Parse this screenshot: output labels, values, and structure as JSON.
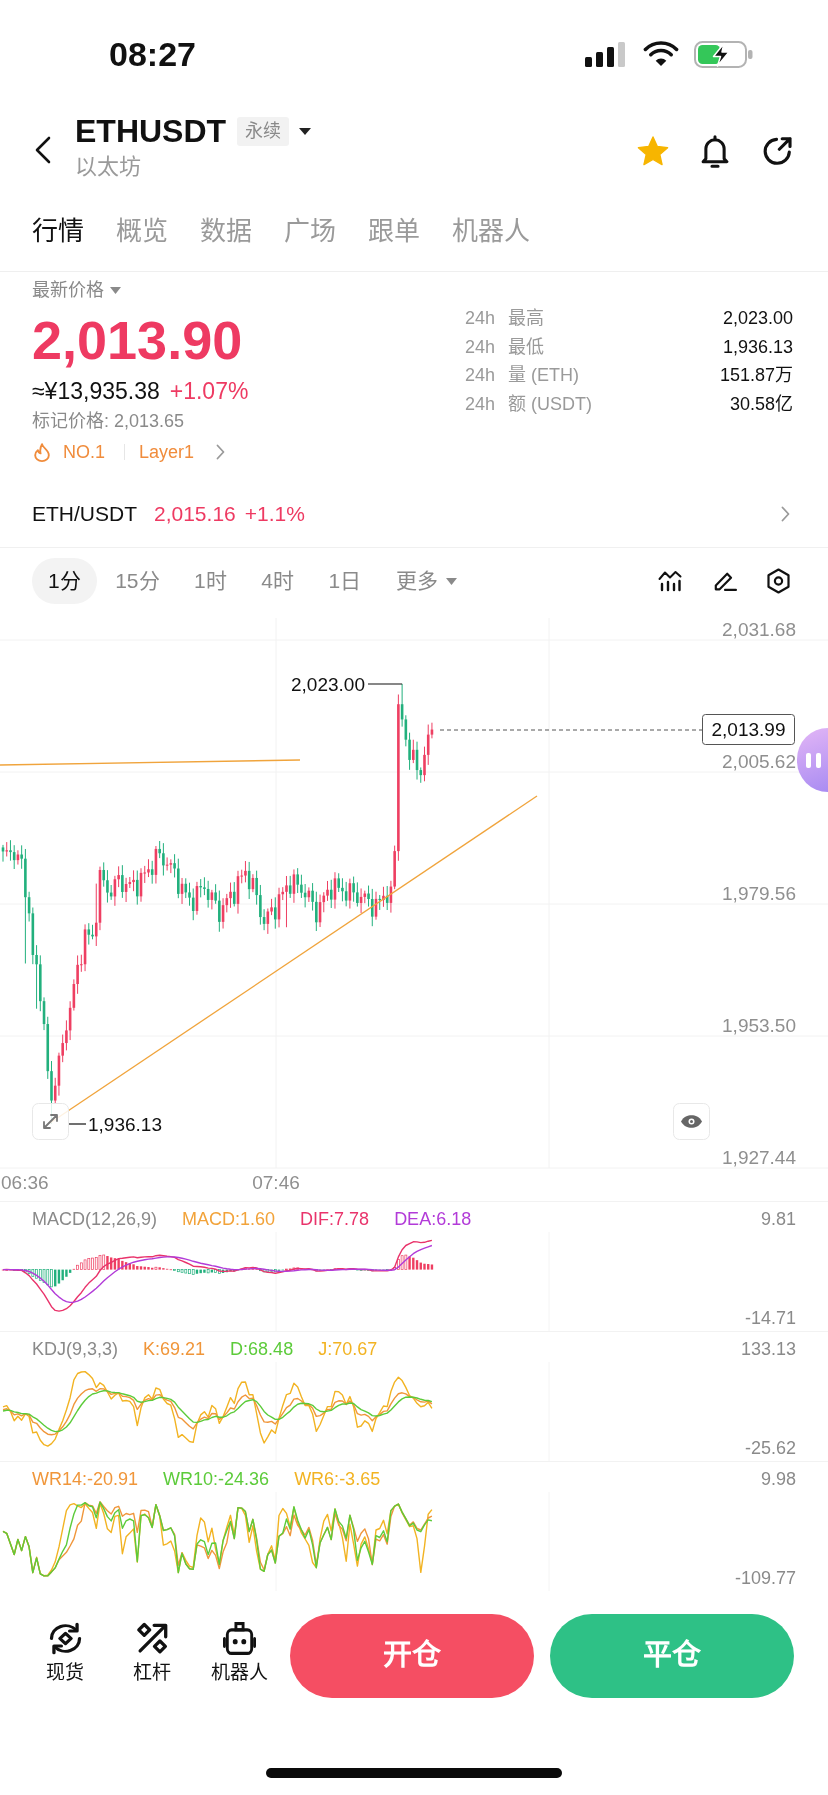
{
  "status_bar": {
    "time": "08:27"
  },
  "header": {
    "symbol": "ETHUSDT",
    "contract_type": "永续",
    "name": "以太坊",
    "favorite": true
  },
  "tabs": [
    {
      "label": "行情",
      "selected": true
    },
    {
      "label": "概览",
      "selected": false
    },
    {
      "label": "数据",
      "selected": false
    },
    {
      "label": "广场",
      "selected": false
    },
    {
      "label": "跟单",
      "selected": false
    },
    {
      "label": "机器人",
      "selected": false
    }
  ],
  "price_panel": {
    "label": "最新价格",
    "last_price": "2,013.90",
    "fiat_price": "≈¥13,935.38",
    "change": "+1.07%",
    "mark_price": "标记价格: 2,013.65",
    "rank": "NO.1",
    "sector": "Layer1",
    "stats": [
      {
        "period": "24h",
        "label": "最高",
        "value": "2,023.00"
      },
      {
        "period": "24h",
        "label": "最低",
        "value": "1,936.13"
      },
      {
        "period": "24h",
        "label": "量 (ETH)",
        "value": "151.87万"
      },
      {
        "period": "24h",
        "label": "额 (USDT)",
        "value": "30.58亿"
      }
    ]
  },
  "spot_pair": {
    "pair": "ETH/USDT",
    "price": "2,015.16",
    "change": "+1.1%"
  },
  "timeframes": [
    {
      "label": "1分",
      "kind": "interval",
      "selected": true
    },
    {
      "label": "15分",
      "kind": "interval",
      "selected": false
    },
    {
      "label": "1时",
      "kind": "interval",
      "selected": false
    },
    {
      "label": "4时",
      "kind": "interval",
      "selected": false
    },
    {
      "label": "1日",
      "kind": "interval",
      "selected": false
    },
    {
      "label": "更多",
      "kind": "menu",
      "selected": false
    }
  ],
  "chart": {
    "price_axis": [
      "2,031.68",
      "2,005.62",
      "1,979.56",
      "1,953.50",
      "1,927.44"
    ],
    "time_axis": [
      "06:36",
      "07:46"
    ],
    "high_label": "2,023.00",
    "low_label": "1,936.13",
    "current_price": "2,013.99"
  },
  "indicators": [
    {
      "kind": "macd",
      "title": "MACD(12,26,9)",
      "values": [
        {
          "text": "MACD:1.60",
          "color": "#f2a33a"
        },
        {
          "text": "DIF:7.78",
          "color": "#e9336b"
        },
        {
          "text": "DEA:6.18",
          "color": "#b23bd8"
        }
      ],
      "axis_max": "9.81",
      "axis_min": "-14.71"
    },
    {
      "kind": "kdj",
      "title": "KDJ(9,3,3)",
      "values": [
        {
          "text": "K:69.21",
          "color": "#f0963a"
        },
        {
          "text": "D:68.48",
          "color": "#5ccb3a"
        },
        {
          "text": "J:70.67",
          "color": "#f2b322"
        }
      ],
      "axis_max": "133.13",
      "axis_min": "-25.62"
    },
    {
      "kind": "wr",
      "values": [
        {
          "text": "WR14:-20.91",
          "color": "#f0963a"
        },
        {
          "text": "WR10:-24.36",
          "color": "#5ccb3a"
        },
        {
          "text": "WR6:-3.65",
          "color": "#f2b322"
        }
      ],
      "axis_max": "9.98",
      "axis_min": "-109.77"
    }
  ],
  "bottom_bar": {
    "shortcuts": [
      {
        "kind": "spot",
        "label": "现货"
      },
      {
        "kind": "margin",
        "label": "杠杆"
      },
      {
        "kind": "bot",
        "label": "机器人"
      }
    ],
    "actions": [
      {
        "kind": "open",
        "label": "开仓"
      },
      {
        "kind": "close",
        "label": "平仓"
      }
    ]
  }
}
